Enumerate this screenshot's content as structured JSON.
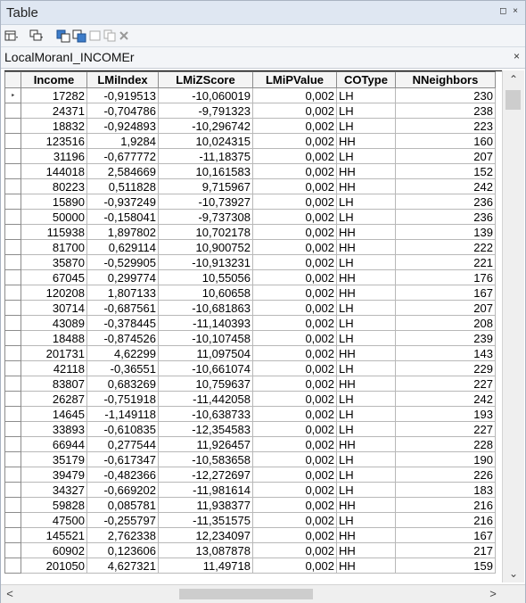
{
  "window": {
    "title": "Table",
    "controls": "◻ ×"
  },
  "tab": {
    "title": "LocalMoranI_INCOMEr",
    "close": "×"
  },
  "columns": [
    "Income",
    "LMiIndex",
    "LMiZScore",
    "LMiPValue",
    "COType",
    "NNeighbors"
  ],
  "current_row_marker": "‣",
  "rows": [
    [
      "17282",
      "-0,919513",
      "-10,060019",
      "0,002",
      "LH",
      "230"
    ],
    [
      "24371",
      "-0,704786",
      "-9,791323",
      "0,002",
      "LH",
      "238"
    ],
    [
      "18832",
      "-0,924893",
      "-10,296742",
      "0,002",
      "LH",
      "223"
    ],
    [
      "123516",
      "1,9284",
      "10,024315",
      "0,002",
      "HH",
      "160"
    ],
    [
      "31196",
      "-0,677772",
      "-11,18375",
      "0,002",
      "LH",
      "207"
    ],
    [
      "144018",
      "2,584669",
      "10,161583",
      "0,002",
      "HH",
      "152"
    ],
    [
      "80223",
      "0,511828",
      "9,715967",
      "0,002",
      "HH",
      "242"
    ],
    [
      "15890",
      "-0,937249",
      "-10,73927",
      "0,002",
      "LH",
      "236"
    ],
    [
      "50000",
      "-0,158041",
      "-9,737308",
      "0,002",
      "LH",
      "236"
    ],
    [
      "115938",
      "1,897802",
      "10,702178",
      "0,002",
      "HH",
      "139"
    ],
    [
      "81700",
      "0,629114",
      "10,900752",
      "0,002",
      "HH",
      "222"
    ],
    [
      "35870",
      "-0,529905",
      "-10,913231",
      "0,002",
      "LH",
      "221"
    ],
    [
      "67045",
      "0,299774",
      "10,55056",
      "0,002",
      "HH",
      "176"
    ],
    [
      "120208",
      "1,807133",
      "10,60658",
      "0,002",
      "HH",
      "167"
    ],
    [
      "30714",
      "-0,687561",
      "-10,681863",
      "0,002",
      "LH",
      "207"
    ],
    [
      "43089",
      "-0,378445",
      "-11,140393",
      "0,002",
      "LH",
      "208"
    ],
    [
      "18488",
      "-0,874526",
      "-10,107458",
      "0,002",
      "LH",
      "239"
    ],
    [
      "201731",
      "4,62299",
      "11,097504",
      "0,002",
      "HH",
      "143"
    ],
    [
      "42118",
      "-0,36551",
      "-10,661074",
      "0,002",
      "LH",
      "229"
    ],
    [
      "83807",
      "0,683269",
      "10,759637",
      "0,002",
      "HH",
      "227"
    ],
    [
      "26287",
      "-0,751918",
      "-11,442058",
      "0,002",
      "LH",
      "242"
    ],
    [
      "14645",
      "-1,149118",
      "-10,638733",
      "0,002",
      "LH",
      "193"
    ],
    [
      "33893",
      "-0,610835",
      "-12,354583",
      "0,002",
      "LH",
      "227"
    ],
    [
      "66944",
      "0,277544",
      "11,926457",
      "0,002",
      "HH",
      "228"
    ],
    [
      "35179",
      "-0,617347",
      "-10,583658",
      "0,002",
      "LH",
      "190"
    ],
    [
      "39479",
      "-0,482366",
      "-12,272697",
      "0,002",
      "LH",
      "226"
    ],
    [
      "34327",
      "-0,669202",
      "-11,981614",
      "0,002",
      "LH",
      "183"
    ],
    [
      "59828",
      "0,085781",
      "11,938377",
      "0,002",
      "HH",
      "216"
    ],
    [
      "47500",
      "-0,255797",
      "-11,351575",
      "0,002",
      "LH",
      "216"
    ],
    [
      "145521",
      "2,762338",
      "12,234097",
      "0,002",
      "HH",
      "167"
    ],
    [
      "60902",
      "0,123606",
      "13,087878",
      "0,002",
      "HH",
      "217"
    ],
    [
      "201050",
      "4,627321",
      "11,49718",
      "0,002",
      "HH",
      "159"
    ]
  ],
  "scroll": {
    "up": "⌃",
    "down": "⌄",
    "left": "<",
    "right": ">"
  }
}
